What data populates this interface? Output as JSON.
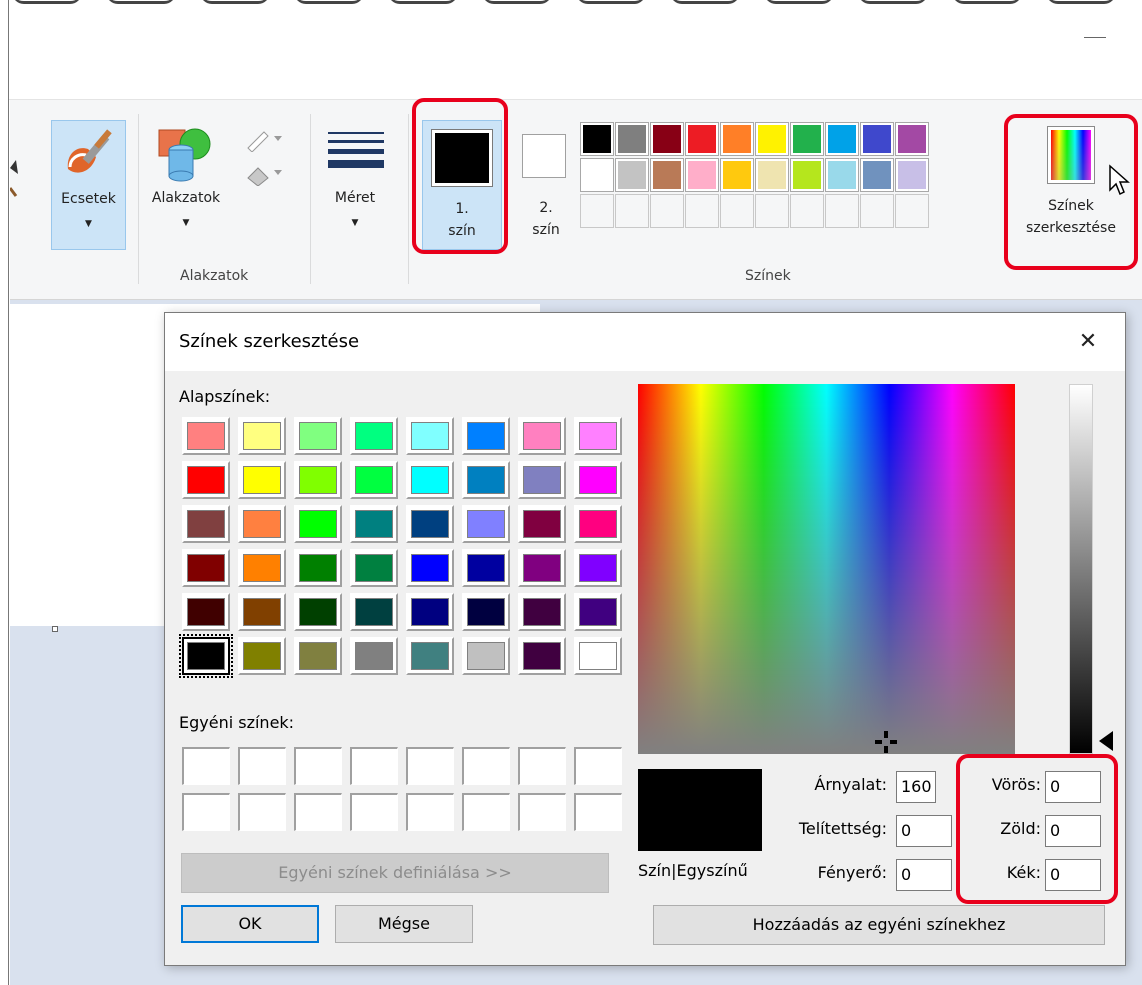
{
  "ribbon": {
    "brushes": {
      "label": "Ecsetek"
    },
    "shapes": {
      "label": "Alakzatok",
      "group_label": "Alakzatok"
    },
    "size": {
      "label": "Méret"
    },
    "color1": {
      "line1": "1.",
      "line2": "szín",
      "color": "#000000"
    },
    "color2": {
      "line1": "2.",
      "line2": "szín",
      "color": "#ffffff"
    },
    "colors_group_label": "Színek",
    "edit_colors": {
      "line1": "Színek",
      "line2": "szerkesztése"
    },
    "palette": {
      "row1": [
        "#000000",
        "#7f7f7f",
        "#880015",
        "#ed1c24",
        "#ff7f27",
        "#fff200",
        "#22b14c",
        "#00a2e8",
        "#3f48cc",
        "#a349a4"
      ],
      "row2": [
        "#ffffff",
        "#c3c3c3",
        "#b97a57",
        "#ffaec9",
        "#ffc90e",
        "#efe4b0",
        "#b5e61d",
        "#99d9ea",
        "#7092be",
        "#c8bfe7"
      ]
    }
  },
  "dialog": {
    "title": "Színek szerkesztése",
    "close_glyph": "✕",
    "basic_colors_label": "Alapszínek:",
    "basic_colors": [
      [
        "#ff8080",
        "#ffff80",
        "#80ff80",
        "#00ff80",
        "#80ffff",
        "#0080ff",
        "#ff80c0",
        "#ff80ff"
      ],
      [
        "#ff0000",
        "#ffff00",
        "#80ff00",
        "#00ff40",
        "#00ffff",
        "#0080c0",
        "#8080c0",
        "#ff00ff"
      ],
      [
        "#804040",
        "#ff8040",
        "#00ff00",
        "#008080",
        "#004080",
        "#8080ff",
        "#800040",
        "#ff0080"
      ],
      [
        "#800000",
        "#ff8000",
        "#008000",
        "#008040",
        "#0000ff",
        "#0000a0",
        "#800080",
        "#8000ff"
      ],
      [
        "#400000",
        "#804000",
        "#004000",
        "#004040",
        "#000080",
        "#000040",
        "#400040",
        "#400080"
      ],
      [
        "#000000",
        "#808000",
        "#808040",
        "#808080",
        "#408080",
        "#c0c0c0",
        "#400040",
        "#ffffff"
      ]
    ],
    "custom_colors_label": "Egyéni színek:",
    "define_custom_button": "Egyéni színek definiálása >>",
    "ok_button": "OK",
    "cancel_button": "Mégse",
    "preview_label": "Szín|Egyszínű",
    "preview_color": "#000000",
    "hue": {
      "label": "Árnyalat:",
      "value": "160"
    },
    "saturation": {
      "label": "Telítettség:",
      "value": "0"
    },
    "luminance": {
      "label": "Fényerő:",
      "value": "0"
    },
    "red": {
      "label": "Vörös:",
      "value": "0"
    },
    "green": {
      "label": "Zöld:",
      "value": "0"
    },
    "blue": {
      "label": "Kék:",
      "value": "0"
    },
    "add_custom_button": "Hozzáadás az egyéni színekhez"
  },
  "accent_colors": {
    "highlight": "#e8001c",
    "selection": "#cce4f7",
    "focus": "#0078d7"
  }
}
